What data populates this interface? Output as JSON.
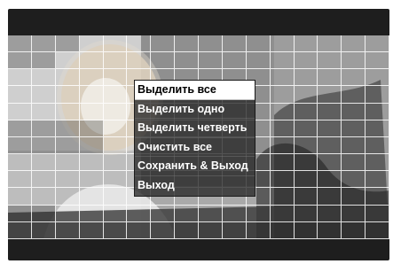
{
  "menu": {
    "items": [
      {
        "label": "Выделить все",
        "selected": true
      },
      {
        "label": "Выделить одно",
        "selected": false
      },
      {
        "label": "Выделить четверть",
        "selected": false
      },
      {
        "label": "Очистить все",
        "selected": false
      },
      {
        "label": "Сохранить & Выход",
        "selected": false
      },
      {
        "label": "Выход",
        "selected": false
      }
    ]
  },
  "colors": {
    "frame": "#1e1e1e",
    "grid_line": "#ffffff",
    "menu_bg": "#282828",
    "menu_selected_bg": "#ffffff",
    "menu_text": "#ffffff",
    "menu_selected_text": "#000000"
  }
}
